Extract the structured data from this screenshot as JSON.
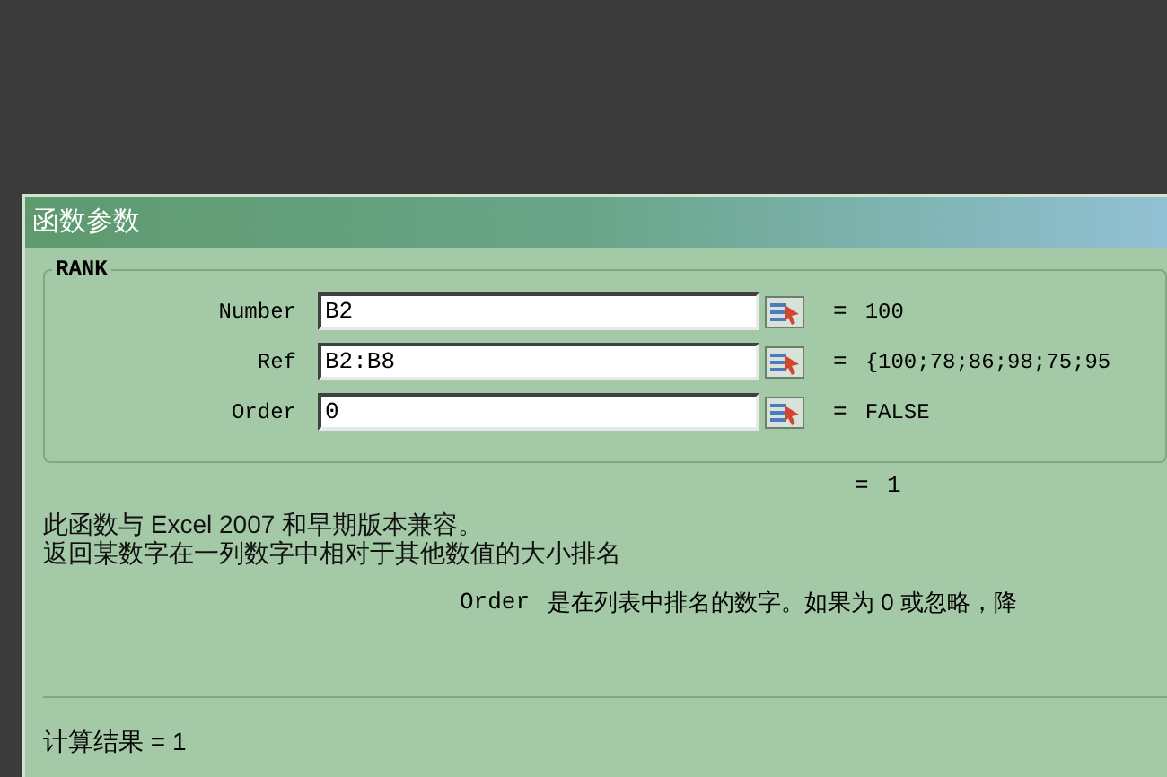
{
  "window": {
    "title": "函数参数"
  },
  "group": {
    "title": "RANK"
  },
  "arguments": [
    {
      "label": "Number",
      "value": "B2",
      "equals": "=",
      "result": "100"
    },
    {
      "label": "Ref",
      "value": "B2:B8",
      "equals": "=",
      "result": "{100;78;86;98;75;95"
    },
    {
      "label": "Order",
      "value": "0",
      "equals": "=",
      "result": "FALSE"
    }
  ],
  "formula_result": {
    "equals": "=",
    "value": "1"
  },
  "description": [
    "此函数与 Excel 2007 和早期版本兼容。",
    "返回某数字在一列数字中相对于其他数值的大小排名"
  ],
  "argument_help": {
    "name": "Order",
    "text": "是在列表中排名的数字。如果为 0 或忽略，降"
  },
  "calculation": "计算结果 = 1"
}
